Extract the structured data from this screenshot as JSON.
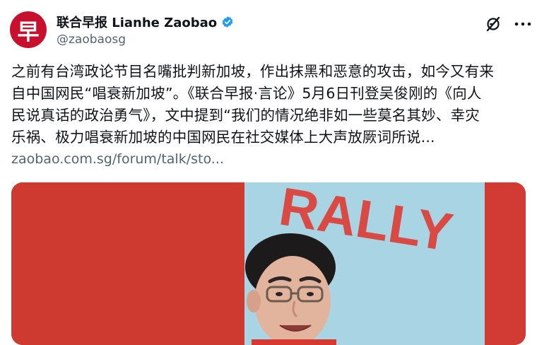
{
  "author": {
    "avatar_char": "早",
    "name": "联合早报 Lianhe Zaobao",
    "handle": "@zaobaosg",
    "verified": true
  },
  "icons": {
    "grok": "grok-icon",
    "more": "more-icon",
    "verified": "verified-badge-icon"
  },
  "tweet": {
    "lines": [
      "之前有台湾政论节目名嘴批判新加坡，作出抹黑和恶意的攻击，如今又有来",
      "自中国网民“唱衰新加坡”。《联合早报·言论》5月6日刊登吴俊刚的《向人",
      "民说真话的政治勇气》，文中提到“我们的情况绝非如一些莫名其妙、幸灾",
      "乐祸、极力唱衰新加坡的中国网民在社交媒体上大声放厥词所说..."
    ],
    "link": "zaobao.com.sg/forum/talk/sto..."
  },
  "media": {
    "banner_text": "RALLY"
  },
  "colors": {
    "brand_red": "#c8102e",
    "verified_blue": "#1d9bf0",
    "secondary_text": "#536471",
    "media_backdrop": "#d43a32",
    "banner_bg": "#a9d4e4",
    "banner_text": "#d94a45"
  }
}
